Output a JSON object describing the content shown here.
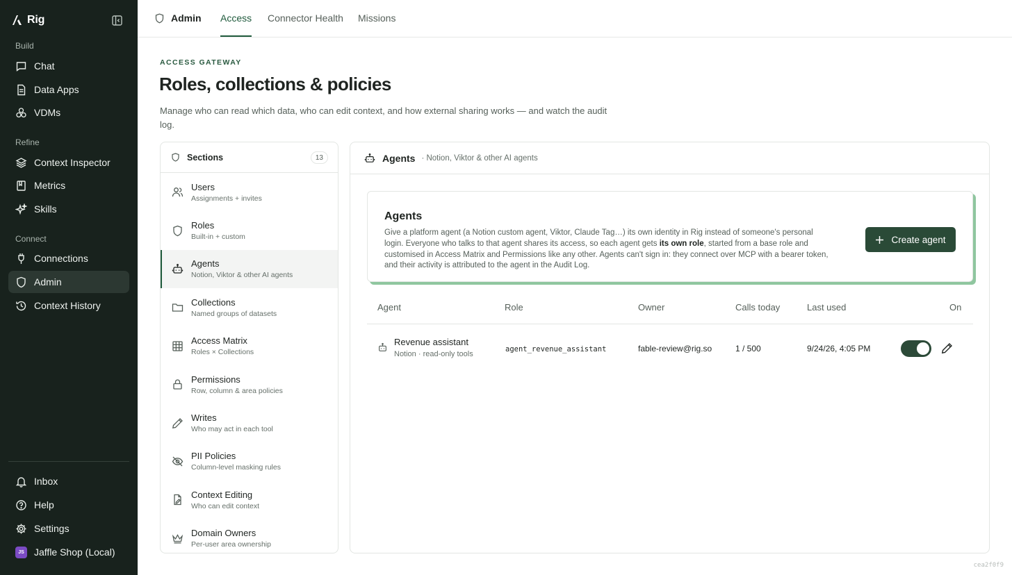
{
  "sidebar": {
    "brand": "Rig",
    "build_label": "Build",
    "refine_label": "Refine",
    "connect_label": "Connect",
    "build": [
      {
        "label": "Chat",
        "icon": "chat-icon"
      },
      {
        "label": "Data Apps",
        "icon": "document-icon"
      },
      {
        "label": "VDMs",
        "icon": "cubes-icon"
      }
    ],
    "refine": [
      {
        "label": "Context Inspector",
        "icon": "layers-icon"
      },
      {
        "label": "Metrics",
        "icon": "book-icon"
      },
      {
        "label": "Skills",
        "icon": "sparkle-icon"
      }
    ],
    "connect": [
      {
        "label": "Connections",
        "icon": "plug-icon"
      },
      {
        "label": "Admin",
        "icon": "shield-icon",
        "active": true
      },
      {
        "label": "Context History",
        "icon": "history-icon"
      }
    ],
    "bottom": [
      {
        "label": "Inbox",
        "icon": "bell-icon"
      },
      {
        "label": "Help",
        "icon": "help-icon"
      },
      {
        "label": "Settings",
        "icon": "gear-icon"
      }
    ],
    "workspace": {
      "initials": "JS",
      "label": "Jaffle Shop (Local)"
    }
  },
  "topbar": {
    "title": "Admin",
    "tabs": [
      "Access",
      "Connector Health",
      "Missions"
    ],
    "active_tab": "Access"
  },
  "page": {
    "eyebrow": "ACCESS GATEWAY",
    "title": "Roles, collections & policies",
    "description": "Manage who can read which data, who can edit context, and how external sharing works — and watch the audit log."
  },
  "sections": {
    "title": "Sections",
    "count": "13",
    "items": [
      {
        "name": "Users",
        "sub": "Assignments + invites",
        "icon": "users-icon"
      },
      {
        "name": "Roles",
        "sub": "Built-in + custom",
        "icon": "shield-icon"
      },
      {
        "name": "Agents",
        "sub": "Notion, Viktor & other AI agents",
        "icon": "bot-icon",
        "active": true
      },
      {
        "name": "Collections",
        "sub": "Named groups of datasets",
        "icon": "folder-icon"
      },
      {
        "name": "Access Matrix",
        "sub": "Roles × Collections",
        "icon": "grid-icon"
      },
      {
        "name": "Permissions",
        "sub": "Row, column & area policies",
        "icon": "lock-icon"
      },
      {
        "name": "Writes",
        "sub": "Who may act in each tool",
        "icon": "pencil-icon"
      },
      {
        "name": "PII Policies",
        "sub": "Column-level masking rules",
        "icon": "eye-off-icon"
      },
      {
        "name": "Context Editing",
        "sub": "Who can edit context",
        "icon": "file-edit-icon"
      },
      {
        "name": "Domain Owners",
        "sub": "Per-user area ownership",
        "icon": "crown-icon"
      }
    ]
  },
  "panel": {
    "title": "Agents",
    "subtitle": "· Notion, Viktor & other AI agents",
    "card": {
      "title": "Agents",
      "body_1": "Give a platform agent (a Notion custom agent, Viktor, Claude Tag…) its own identity in Rig instead of someone's personal login. Everyone who talks to that agent shares its access, so each agent gets ",
      "body_bold": "its own role",
      "body_2": ", started from a base role and customised in Access Matrix and Permissions like any other. Agents can't sign in: they connect over MCP with a bearer token, and their activity is attributed to the agent in the Audit Log.",
      "button": "Create agent"
    },
    "table": {
      "columns": [
        "Agent",
        "Role",
        "Owner",
        "Calls today",
        "Last used",
        "On"
      ],
      "rows": [
        {
          "agent": "Revenue assistant",
          "agent_sub": "Notion · read-only tools",
          "role": "agent_revenue_assistant",
          "owner": "fable-review@rig.so",
          "calls": "1 / 500",
          "last_used": "9/24/26, 4:05 PM",
          "enabled": true
        }
      ]
    }
  },
  "footer": {
    "hash": "cea2f0f9"
  },
  "colors": {
    "sidebar_bg": "#18221d",
    "accent": "#1f5a3c",
    "button": "#2a4a37",
    "card_shadow": "#8fc69f"
  }
}
